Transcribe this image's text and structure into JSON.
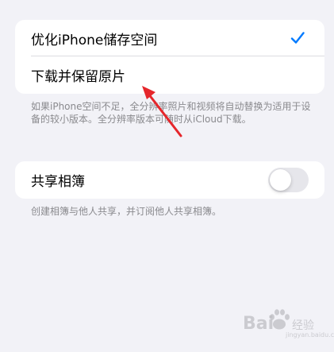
{
  "photos_group": {
    "optimize_label": "优化iPhone储存空间",
    "optimize_selected": true,
    "download_label": "下载并保留原片",
    "download_selected": false
  },
  "photos_footnote": "如果iPhone空间不足，全分辨率照片和视频将自动替换为适用于设备的较小版本。全分辨率版本可随时从iCloud下载。",
  "shared_group": {
    "label": "共享相簿",
    "toggle_on": false
  },
  "shared_footnote": "创建相簿与他人共享，并订阅他人共享相簿。",
  "watermark": {
    "brand": "Bai",
    "suffix": "经验",
    "url": "jingyan.baidu.com"
  },
  "colors": {
    "accent": "#007aff",
    "annotation": "#e5262b",
    "background": "#f2f2f7",
    "secondary_text": "#8a8a8e"
  },
  "icons": {
    "checkmark": "checkmark-icon",
    "annotation": "red-arrow-icon",
    "watermark": "baidu-paw-icon"
  }
}
